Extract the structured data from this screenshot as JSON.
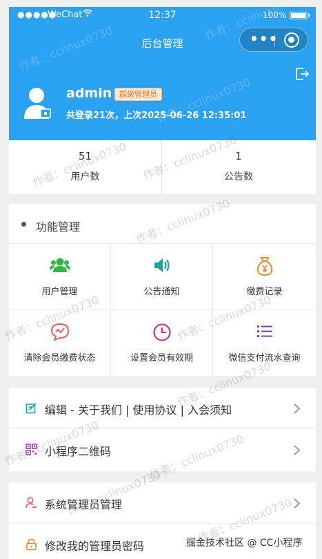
{
  "status_bar": {
    "carrier": "WeChat",
    "time": "12:37",
    "battery": "100%"
  },
  "nav": {
    "title": "后台管理"
  },
  "profile": {
    "username": "admin",
    "role_badge": "超级管理员",
    "login_info": "共登录21次，上次2025-06-26 12:35:01"
  },
  "stats": [
    {
      "value": "51",
      "label": "用户数"
    },
    {
      "value": "1",
      "label": "公告数"
    }
  ],
  "functions": {
    "title": "功能管理",
    "items": [
      {
        "label": "用户管理",
        "icon": "users-icon",
        "color": "#37b34a"
      },
      {
        "label": "公告通知",
        "icon": "speaker-icon",
        "color": "#1aa39a"
      },
      {
        "label": "缴费记录",
        "icon": "money-bag-icon",
        "color": "#f08a24"
      },
      {
        "label": "清除会员缴费状态",
        "icon": "chat-clear-icon",
        "color": "#ee5a5a"
      },
      {
        "label": "设置会员有效期",
        "icon": "clock-icon",
        "color": "#c13c8c"
      },
      {
        "label": "微信支付流水查询",
        "icon": "list-icon",
        "color": "#6c44a8"
      }
    ]
  },
  "menu1": [
    {
      "label": "编辑 - 关于我们 | 使用协议 | 入会须知",
      "icon": "edit-icon",
      "color": "#1aa39a"
    },
    {
      "label": "小程序二维码",
      "icon": "qrcode-icon",
      "color": "#9a3fb3"
    }
  ],
  "menu2": [
    {
      "label": "系统管理员管理",
      "icon": "admin-user-icon",
      "color": "#ee5a5a"
    },
    {
      "label": "修改我的管理员密码",
      "icon": "lock-icon",
      "color": "#f08a24"
    }
  ],
  "watermark": "作者：cclinux0730",
  "footer_credit": "掘金技术社区 @ CC小程序"
}
